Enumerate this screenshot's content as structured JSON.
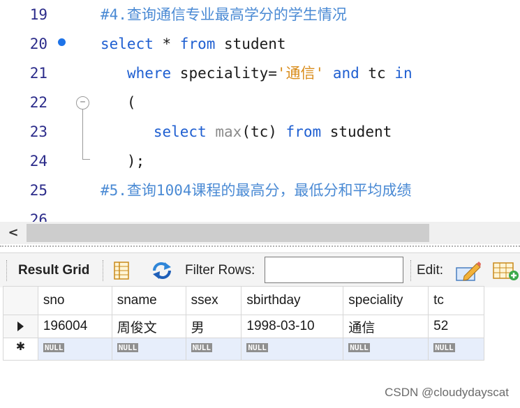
{
  "editor": {
    "lines": [
      {
        "num": "19",
        "segments": [
          {
            "text": "#4.查询通信专业最高学分的学生情况",
            "cls": "cmt"
          }
        ]
      },
      {
        "num": "20",
        "segments": [
          {
            "text": "select",
            "cls": "kw"
          },
          {
            "text": " * ",
            "cls": ""
          },
          {
            "text": "from",
            "cls": "kw"
          },
          {
            "text": " student",
            "cls": ""
          }
        ]
      },
      {
        "num": "21",
        "segments": [
          {
            "text": "   ",
            "cls": ""
          },
          {
            "text": "where",
            "cls": "kw"
          },
          {
            "text": " speciality=",
            "cls": ""
          },
          {
            "text": "'通信'",
            "cls": "str"
          },
          {
            "text": " ",
            "cls": ""
          },
          {
            "text": "and",
            "cls": "kw"
          },
          {
            "text": " tc ",
            "cls": ""
          },
          {
            "text": "in",
            "cls": "kw"
          }
        ]
      },
      {
        "num": "22",
        "segments": [
          {
            "text": "   (",
            "cls": ""
          }
        ]
      },
      {
        "num": "23",
        "segments": [
          {
            "text": "      ",
            "cls": ""
          },
          {
            "text": "select",
            "cls": "kw"
          },
          {
            "text": " ",
            "cls": ""
          },
          {
            "text": "max",
            "cls": "fn"
          },
          {
            "text": "(tc) ",
            "cls": ""
          },
          {
            "text": "from",
            "cls": "kw"
          },
          {
            "text": " student",
            "cls": ""
          }
        ]
      },
      {
        "num": "24",
        "segments": [
          {
            "text": "   );",
            "cls": ""
          }
        ]
      },
      {
        "num": "25",
        "segments": [
          {
            "text": "#5.查询1004课程的最高分，最低分和平均成绩",
            "cls": "cmt"
          }
        ]
      },
      {
        "num": "26",
        "segments": []
      }
    ],
    "fold_symbol": "−"
  },
  "scrollbar": {
    "left_arrow": "<"
  },
  "toolbar": {
    "result_grid_label": "Result Grid",
    "filter_rows_label": "Filter Rows:",
    "filter_value": "",
    "edit_label": "Edit:"
  },
  "grid": {
    "columns": [
      "sno",
      "sname",
      "ssex",
      "sbirthday",
      "speciality",
      "tc"
    ],
    "rows": [
      [
        "196004",
        "周俊文",
        "男",
        "1998-03-10",
        "通信",
        "52"
      ]
    ],
    "null_label": "NULL",
    "new_row_marker": "✱"
  },
  "watermark": "CSDN @cloudydayscat",
  "colors": {
    "keyword": "#1f5fd1",
    "string": "#d98c1a",
    "comment": "#4a8ad4",
    "line_number": "#2b2b8a",
    "breakpoint": "#1e73e8"
  }
}
